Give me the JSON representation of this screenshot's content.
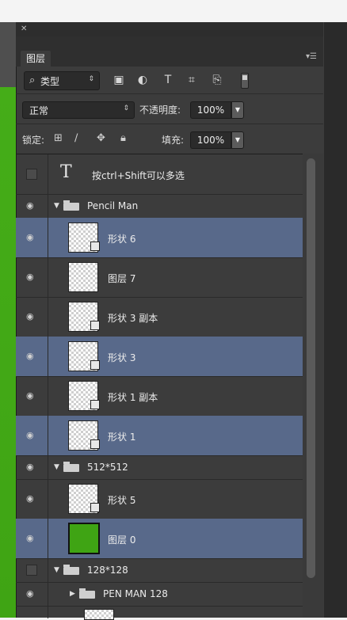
{
  "panel": {
    "tab_label": "图层",
    "menu_icon": "panel-menu-icon",
    "close_glyph": "✕"
  },
  "filter": {
    "kind_label": "类型",
    "icons": [
      "image-filter-icon",
      "adjustment-filter-icon",
      "type-filter-icon",
      "shape-filter-icon",
      "smartobject-filter-icon"
    ]
  },
  "blend": {
    "mode": "正常",
    "opacity_label": "不透明度:",
    "opacity_value": "100%",
    "fill_label": "填充:",
    "fill_value": "100%"
  },
  "lock": {
    "label": "锁定:",
    "icons": [
      "lock-transparent-icon",
      "lock-pixels-icon",
      "lock-position-icon",
      "lock-all-icon"
    ]
  },
  "layers": [
    {
      "kind": "text",
      "name": "按ctrl+Shift可以多选",
      "visible": false,
      "selected": false
    },
    {
      "kind": "group",
      "name": "Pencil Man",
      "visible": true,
      "expanded": true
    },
    {
      "kind": "shape",
      "name": "形状 6",
      "visible": true,
      "selected": true
    },
    {
      "kind": "shape",
      "name": "图层 7",
      "visible": true,
      "selected": false
    },
    {
      "kind": "shape",
      "name": "形状 3 副本",
      "visible": true,
      "selected": false
    },
    {
      "kind": "shape",
      "name": "形状 3",
      "visible": true,
      "selected": true
    },
    {
      "kind": "shape",
      "name": "形状 1 副本",
      "visible": true,
      "selected": false
    },
    {
      "kind": "shape",
      "name": "形状 1",
      "visible": true,
      "selected": true
    },
    {
      "kind": "group",
      "name": "512*512",
      "visible": true,
      "expanded": true
    },
    {
      "kind": "shape",
      "name": "形状 5",
      "visible": true,
      "selected": false
    },
    {
      "kind": "fill",
      "name": "图层 0",
      "visible": true,
      "selected": true,
      "color": "#3fa414"
    },
    {
      "kind": "group",
      "name": "128*128",
      "visible": false,
      "expanded": true
    },
    {
      "kind": "group",
      "name": "PEN MAN 128",
      "visible": true,
      "expanded": false
    }
  ],
  "colors": {
    "panel_bg": "#3c3c3c",
    "selected_row": "#58698a",
    "canvas_green": "#3fa414"
  }
}
